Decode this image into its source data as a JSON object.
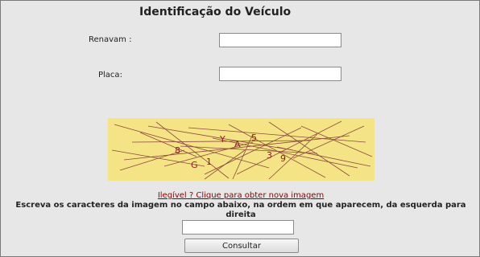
{
  "form": {
    "title": "Identificação do Veículo",
    "renavam_label": "Renavam :",
    "renavam_value": "",
    "placa_label": "Placa:",
    "placa_value": "",
    "captcha_characters": [
      "8",
      "Y",
      "A",
      "5",
      "G",
      "1",
      "3",
      "9"
    ],
    "captcha_background": "#f4e486",
    "captcha_text_color": "#8b1a1a",
    "illegible_link": "Ilegível ? Clique para obter nova imagem",
    "instruction": "Escreva os caracteres da imagem no campo abaixo, na ordem em que aparecem, da esquerda para direita",
    "captcha_answer_value": "",
    "submit_label": "Consultar"
  }
}
